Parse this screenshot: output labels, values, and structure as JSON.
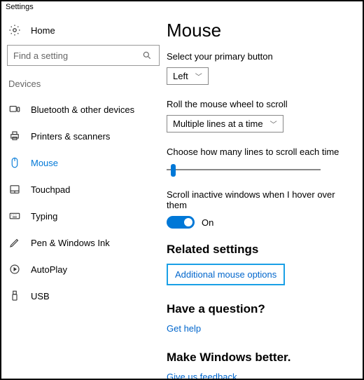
{
  "window": {
    "title": "Settings"
  },
  "sidebar": {
    "home_label": "Home",
    "search_placeholder": "Find a setting",
    "category": "Devices",
    "items": [
      {
        "label": "Bluetooth & other devices"
      },
      {
        "label": "Printers & scanners"
      },
      {
        "label": "Mouse"
      },
      {
        "label": "Touchpad"
      },
      {
        "label": "Typing"
      },
      {
        "label": "Pen & Windows Ink"
      },
      {
        "label": "AutoPlay"
      },
      {
        "label": "USB"
      }
    ]
  },
  "main": {
    "title": "Mouse",
    "primary_button": {
      "label": "Select your primary button",
      "value": "Left"
    },
    "wheel_scroll": {
      "label": "Roll the mouse wheel to scroll",
      "value": "Multiple lines at a time"
    },
    "lines_label": "Choose how many lines to scroll each time",
    "inactive_scroll": {
      "label": "Scroll inactive windows when I hover over them",
      "state": "On"
    },
    "related": {
      "heading": "Related settings",
      "link": "Additional mouse options"
    },
    "question": {
      "heading": "Have a question?",
      "link": "Get help"
    },
    "feedback": {
      "heading": "Make Windows better.",
      "link": "Give us feedback"
    }
  }
}
